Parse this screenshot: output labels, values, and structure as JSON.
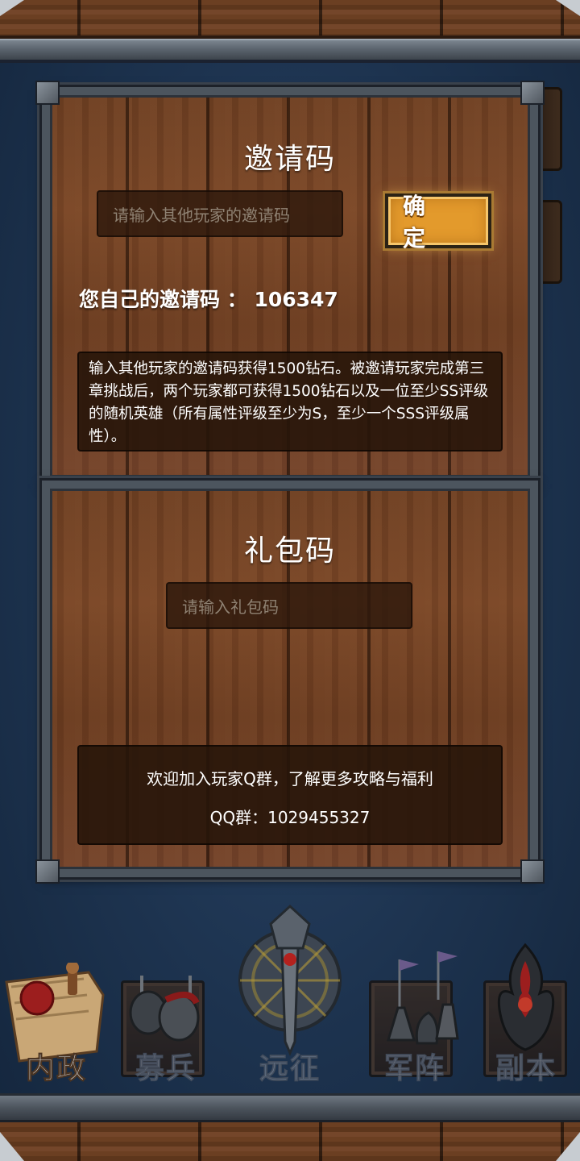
{
  "invite": {
    "title": "邀请码",
    "input_placeholder": "请输入其他玩家的邀请码",
    "confirm_label": "确 定",
    "own_code_label": "您自己的邀请码 ：",
    "own_code_value": "106347",
    "description": "输入其他玩家的邀请码获得1500钻石。被邀请玩家完成第三章挑战后，两个玩家都可获得1500钻石以及一位至少SS评级的随机英雄（所有属性评级至少为S，至少一个SSS评级属性）。"
  },
  "gift": {
    "title": "礼包码",
    "input_placeholder": "请输入礼包码"
  },
  "qq": {
    "welcome_text": "欢迎加入玩家Q群，了解更多攻略与福利",
    "group_label": "QQ群：",
    "group_number": "1029455327"
  },
  "nav": {
    "items": [
      {
        "label": "内政",
        "icon": "scroll-seal-icon",
        "active": true
      },
      {
        "label": "募兵",
        "icon": "knight-helmets-icon",
        "active": false
      },
      {
        "label": "远征",
        "icon": "sword-emblem-icon",
        "active": false
      },
      {
        "label": "军阵",
        "icon": "chess-pieces-icon",
        "active": false
      },
      {
        "label": "副本",
        "icon": "dark-flame-icon",
        "active": false
      }
    ]
  },
  "colors": {
    "confirm_button": "#e39a2c",
    "background": "#1f3553",
    "wood": "#6e3f22"
  }
}
